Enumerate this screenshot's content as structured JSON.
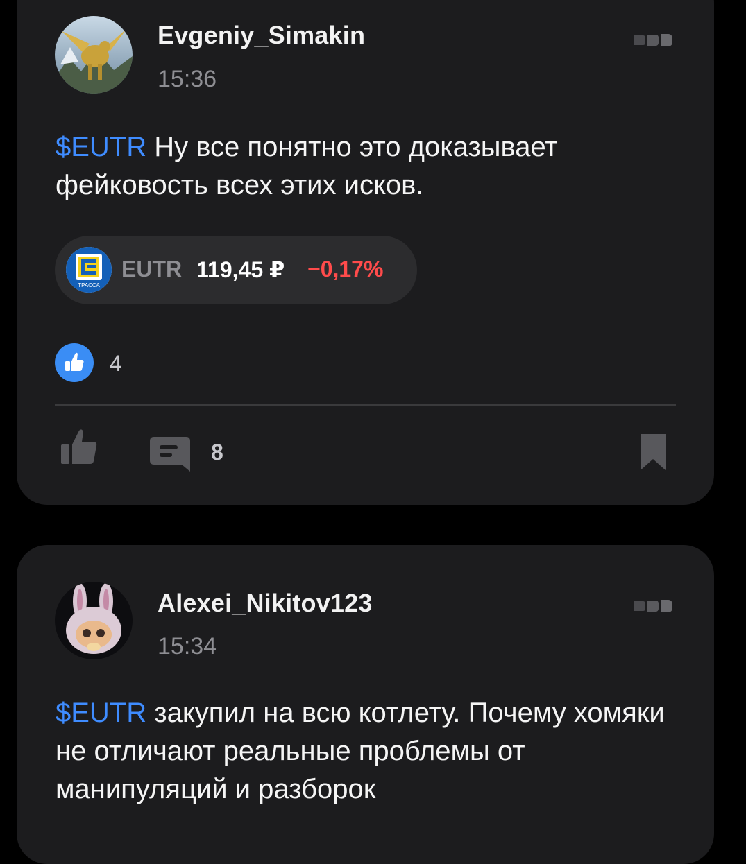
{
  "posts": [
    {
      "author": "Evgeniy_Simakin",
      "time": "15:36",
      "ticker": "$EUTR",
      "text": " Ну все понятно это доказывает фейковость всех этих исков.",
      "quote": {
        "logo_text": "ТРАССА",
        "ticker": "EUTR",
        "price": "119,45 ₽",
        "change": "−0,17%",
        "change_color": "#ff4b4b"
      },
      "reactions_count": "4",
      "comments_count": "8"
    },
    {
      "author": "Alexei_Nikitov123",
      "time": "15:34",
      "ticker": "$EUTR",
      "text": " закупил на всю котлету. Почему хомяки не отличают реальные проблемы от манипуляций и разборок"
    }
  ],
  "colors": {
    "background": "#000000",
    "card": "#1c1c1e",
    "accent": "#3f8cff",
    "negative": "#ff4b4b",
    "reaction": "#3a8df5"
  },
  "icons": {
    "more": "more-dots-icon",
    "reaction": "thumbs-up-reaction-icon",
    "like": "thumbs-up-icon",
    "comment": "comment-icon",
    "bookmark": "bookmark-icon"
  }
}
